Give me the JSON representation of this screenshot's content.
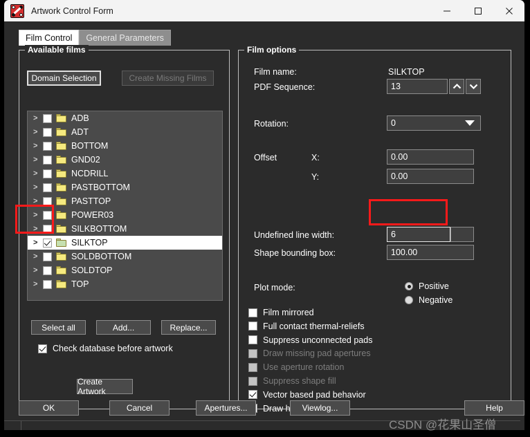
{
  "window": {
    "title": "Artwork Control Form",
    "app_icon": "artwork-app-icon",
    "minimize_label": "Minimize",
    "maximize_label": "Maximize",
    "close_label": "Close"
  },
  "tabs": [
    {
      "label": "Film Control",
      "active": true
    },
    {
      "label": "General Parameters",
      "active": false
    }
  ],
  "available_films": {
    "group_title": "Available films",
    "domain_selection_button": "Domain Selection",
    "create_missing_films_button": "Create Missing Films",
    "films": [
      {
        "name": "ADB",
        "checked": false,
        "selected": false
      },
      {
        "name": "ADT",
        "checked": false,
        "selected": false
      },
      {
        "name": "BOTTOM",
        "checked": false,
        "selected": false
      },
      {
        "name": "GND02",
        "checked": false,
        "selected": false
      },
      {
        "name": "NCDRILL",
        "checked": false,
        "selected": false
      },
      {
        "name": "PASTBOTTOM",
        "checked": false,
        "selected": false
      },
      {
        "name": "PASTTOP",
        "checked": false,
        "selected": false
      },
      {
        "name": "POWER03",
        "checked": false,
        "selected": false
      },
      {
        "name": "SILKBOTTOM",
        "checked": false,
        "selected": false
      },
      {
        "name": "SILKTOP",
        "checked": true,
        "selected": true
      },
      {
        "name": "SOLDBOTTOM",
        "checked": false,
        "selected": false
      },
      {
        "name": "SOLDTOP",
        "checked": false,
        "selected": false
      },
      {
        "name": "TOP",
        "checked": false,
        "selected": false
      }
    ],
    "select_all_button": "Select all",
    "add_button": "Add...",
    "replace_button": "Replace...",
    "check_database_label": "Check database before artwork",
    "check_database_checked": true,
    "create_artwork_button": "Create Artwork"
  },
  "film_options": {
    "group_title": "Film options",
    "film_name_label": "Film name:",
    "film_name_value": "SILKTOP",
    "pdf_sequence_label": "PDF Sequence:",
    "pdf_sequence_value": "13",
    "spin_up_icon": "chevron-up-icon",
    "spin_down_icon": "chevron-down-icon",
    "rotation_label": "Rotation:",
    "rotation_value": "0",
    "rotation_arrow_icon": "chevron-down-icon",
    "offset_label": "Offset",
    "offset_x_label": "X:",
    "offset_x_value": "0.00",
    "offset_y_label": "Y:",
    "offset_y_value": "0.00",
    "undefined_line_width_label": "Undefined line width:",
    "undefined_line_width_value": "6",
    "shape_bounding_box_label": "Shape bounding box:",
    "shape_bounding_box_value": "100.00",
    "plot_mode_label": "Plot mode:",
    "plot_mode_options": [
      {
        "label": "Positive",
        "selected": true
      },
      {
        "label": "Negative",
        "selected": false
      }
    ],
    "checkboxes": [
      {
        "label": "Film mirrored",
        "checked": false,
        "disabled": false
      },
      {
        "label": "Full contact thermal-reliefs",
        "checked": false,
        "disabled": false
      },
      {
        "label": "Suppress unconnected pads",
        "checked": false,
        "disabled": false
      },
      {
        "label": "Draw missing pad apertures",
        "checked": false,
        "disabled": true
      },
      {
        "label": "Use aperture rotation",
        "checked": false,
        "disabled": true
      },
      {
        "label": "Suppress shape fill",
        "checked": false,
        "disabled": true
      },
      {
        "label": "Vector based pad behavior",
        "checked": true,
        "disabled": false
      },
      {
        "label": "Draw holes only",
        "checked": false,
        "disabled": false
      }
    ]
  },
  "dialog_buttons": {
    "ok": "OK",
    "cancel": "Cancel",
    "apertures": "Apertures...",
    "viewlog": "Viewlog...",
    "help": "Help"
  },
  "annotations": {
    "highlight_color": "#fb1a1a",
    "silktop_row": "red-highlight-around-silktop-checkbox",
    "line_width_field": "red-highlight-around-undefined-line-width"
  },
  "watermark": {
    "text": "CSDN @花果山圣僧"
  },
  "colors": {
    "dialog_background": "#2b2b2b",
    "titlebar": "#f3f3f3",
    "list_background": "#4a4a4a",
    "field_background": "#3f3f3f",
    "accent_red": "#fb1a1a",
    "folder_yellow": "#f5e97f"
  }
}
